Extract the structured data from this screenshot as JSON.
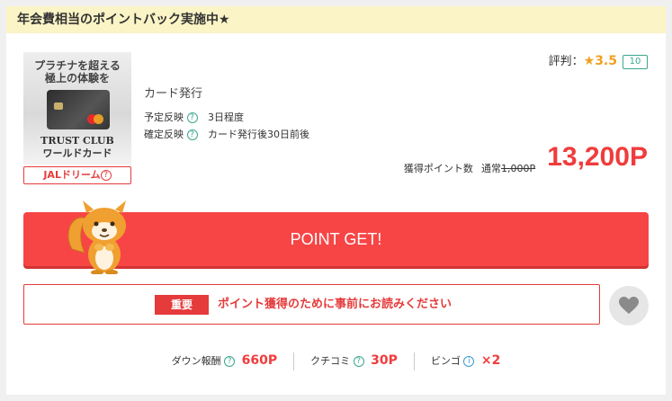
{
  "banner": {
    "text": "年会費相当のポイントバック実施中★"
  },
  "thumbnail": {
    "line1": "プラチナを超える",
    "line2": "極上の体験を",
    "line3": "TRUST CLUB",
    "line4": "ワールドカード"
  },
  "tag": {
    "label": "JALドリーム",
    "help_glyph": "?"
  },
  "rating": {
    "label": "評判：",
    "star": "★",
    "score": "3.5",
    "review_count": "10"
  },
  "offer": {
    "title": "カード発行",
    "rows": [
      {
        "label": "予定反映",
        "value": "3日程度"
      },
      {
        "label": "確定反映",
        "value": "カード発行後30日前後"
      }
    ],
    "help_glyph": "?"
  },
  "points": {
    "label": "獲得ポイント数",
    "usual_label": "通常",
    "usual_value": "1,000P",
    "value": "13,200P"
  },
  "cta": {
    "label": "POINT GET!"
  },
  "notice": {
    "badge": "重要",
    "text": "ポイント獲得のために事前にお読みください"
  },
  "favorite": {
    "icon": "heart-icon"
  },
  "stats": [
    {
      "label": "ダウン報酬",
      "help": "?",
      "value": "660P"
    },
    {
      "label": "クチコミ",
      "help": "?",
      "value": "30P"
    },
    {
      "label": "ビンゴ",
      "help": "i",
      "value": "×2"
    }
  ],
  "colors": {
    "accent": "#f74545",
    "banner_bg": "#fbf4c6",
    "teal": "#3aa88e",
    "star": "#f0a020"
  }
}
